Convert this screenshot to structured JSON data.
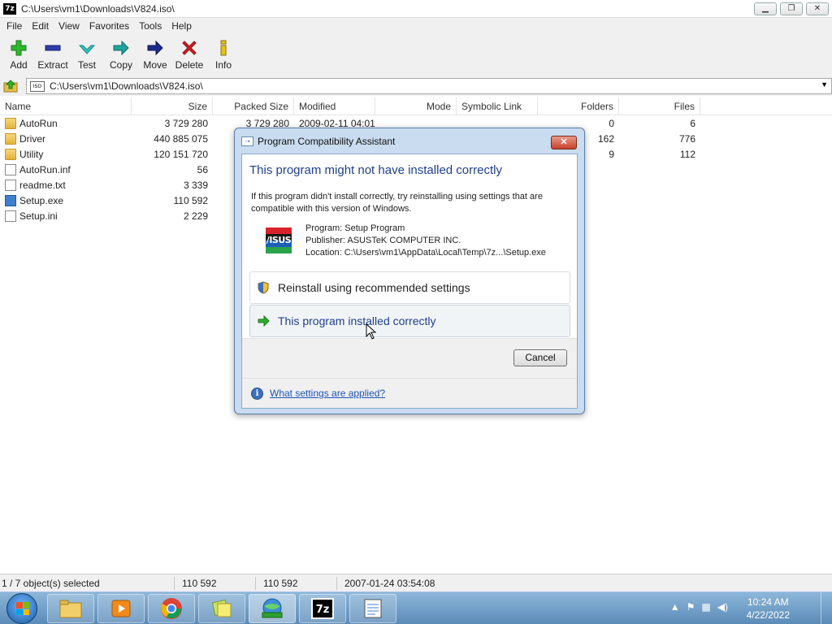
{
  "window": {
    "app_icon_text": "7z",
    "title": "C:\\Users\\vm1\\Downloads\\V824.iso\\"
  },
  "menu": [
    "File",
    "Edit",
    "View",
    "Favorites",
    "Tools",
    "Help"
  ],
  "toolbar": {
    "add": "Add",
    "extract": "Extract",
    "test": "Test",
    "copy": "Copy",
    "move": "Move",
    "delete": "Delete",
    "info": "Info"
  },
  "address": {
    "path": "C:\\Users\\vm1\\Downloads\\V824.iso\\",
    "iso_badge": "ISO"
  },
  "columns": {
    "name": "Name",
    "size": "Size",
    "packed_size": "Packed Size",
    "modified": "Modified",
    "mode": "Mode",
    "symbolic_link": "Symbolic Link",
    "folders": "Folders",
    "files": "Files"
  },
  "files": [
    {
      "name": "AutoRun",
      "size": "3 729 280",
      "packed": "3 729 280",
      "modified": "2009-02-11 04:01",
      "folders": "0",
      "files": "6",
      "type": "folder"
    },
    {
      "name": "Driver",
      "size": "440 885 075",
      "packed": "",
      "modified": "",
      "folders": "162",
      "files": "776",
      "type": "folder"
    },
    {
      "name": "Utility",
      "size": "120 151 720",
      "packed": "",
      "modified": "",
      "folders": "9",
      "files": "112",
      "type": "folder"
    },
    {
      "name": "AutoRun.inf",
      "size": "56",
      "packed": "",
      "modified": "",
      "folders": "",
      "files": "",
      "type": "doc"
    },
    {
      "name": "readme.txt",
      "size": "3 339",
      "packed": "",
      "modified": "",
      "folders": "",
      "files": "",
      "type": "doc"
    },
    {
      "name": "Setup.exe",
      "size": "110 592",
      "packed": "",
      "modified": "",
      "folders": "",
      "files": "",
      "type": "exe"
    },
    {
      "name": "Setup.ini",
      "size": "2 229",
      "packed": "",
      "modified": "",
      "folders": "",
      "files": "",
      "type": "doc"
    }
  ],
  "status": {
    "selection": "1 / 7 object(s) selected",
    "size": "110 592",
    "packed": "110 592",
    "modified": "2007-01-24 03:54:08"
  },
  "dialog": {
    "title": "Program Compatibility Assistant",
    "close_label": "✕",
    "heading": "This program might not have installed correctly",
    "message": "If this program didn't install correctly, try reinstalling using settings that are compatible with this version of Windows.",
    "logo_text": "/ISUS",
    "program": "Program: Setup Program",
    "publisher": "Publisher: ASUSTeK COMPUTER INC.",
    "location": "Location: C:\\Users\\vm1\\AppData\\Local\\Temp\\7z...\\Setup.exe",
    "option_reinstall": "Reinstall using recommended settings",
    "option_ok": "This program installed correctly",
    "cancel": "Cancel",
    "help_link": "What settings are applied?",
    "colors": {
      "heading": "#1e3f8f",
      "link": "#1c53b8"
    }
  },
  "taskbar": {
    "time": "10:24 AM",
    "date": "4/22/2022",
    "seven_zip_label": "7z"
  }
}
